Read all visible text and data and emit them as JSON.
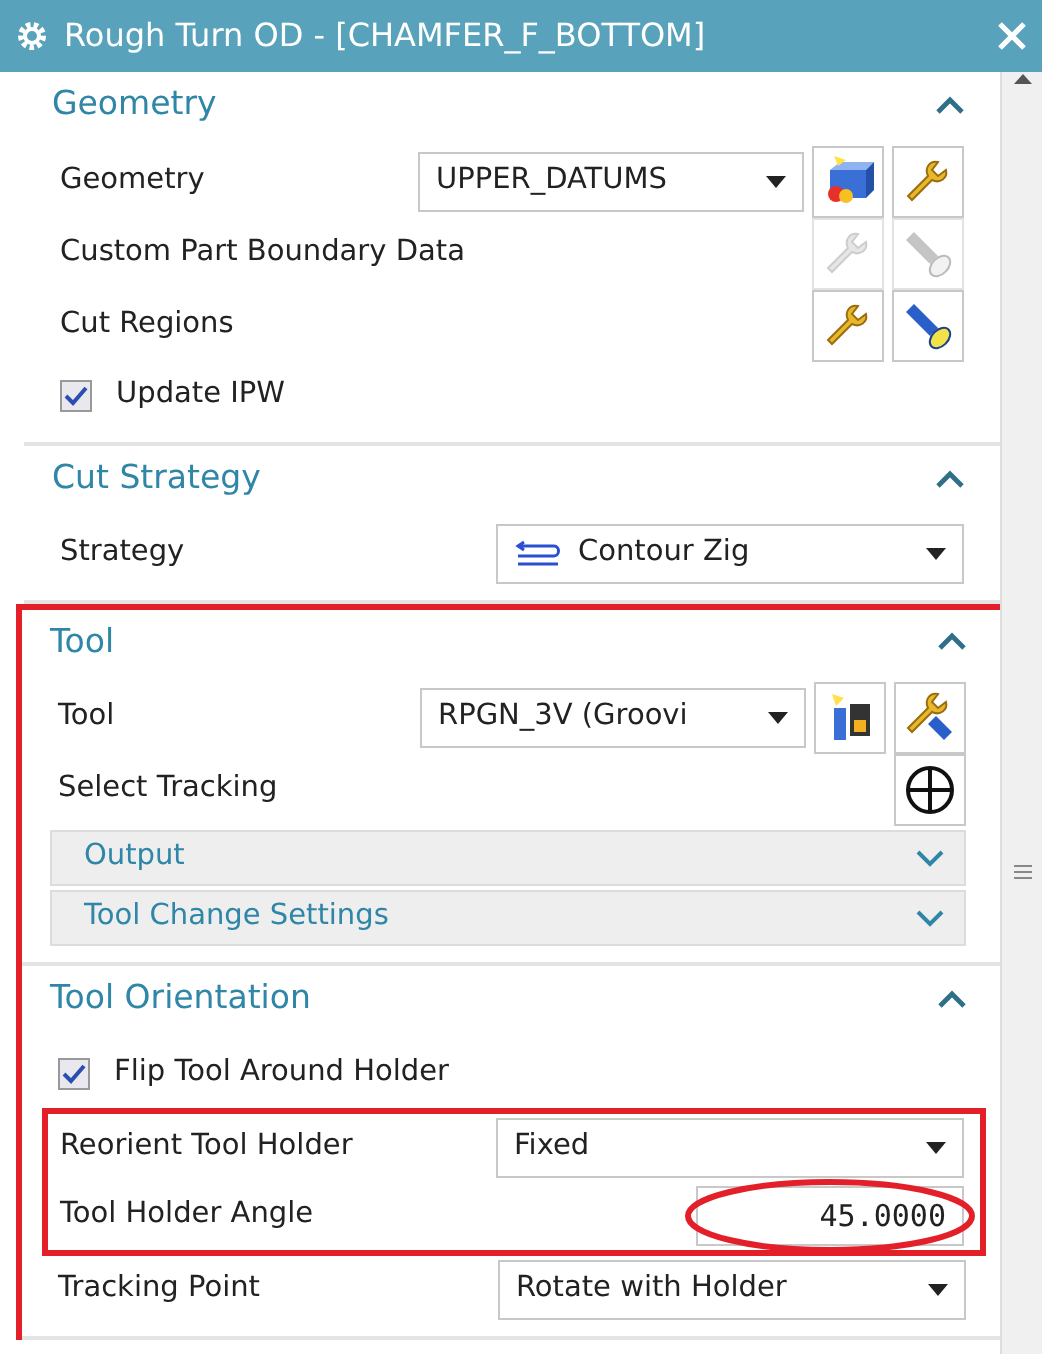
{
  "window": {
    "title": "Rough Turn OD - [CHAMFER_F_BOTTOM]"
  },
  "sections": [
    {
      "title": "Geometry",
      "expanded": true,
      "highlighted": false,
      "rows": [
        {
          "kind": "select",
          "label": "Geometry",
          "value": "UPPER_DATUMS",
          "buttons": [
            {
              "kind": "newbox",
              "disabled": false
            },
            {
              "kind": "wrench",
              "disabled": false
            }
          ]
        },
        {
          "kind": "buttons",
          "label": "Custom Part Boundary Data",
          "buttons": [
            {
              "kind": "wrench",
              "disabled": true
            },
            {
              "kind": "flashlight",
              "disabled": true
            }
          ]
        },
        {
          "kind": "buttons",
          "label": "Cut Regions",
          "buttons": [
            {
              "kind": "wrench",
              "disabled": false
            },
            {
              "kind": "flashlight",
              "disabled": false
            }
          ]
        },
        {
          "kind": "checkbox",
          "label": "Update IPW",
          "checked": true
        }
      ]
    },
    {
      "title": "Cut Strategy",
      "expanded": true,
      "highlighted": false,
      "rows": [
        {
          "kind": "iconselect",
          "label": "Strategy",
          "value": "Contour Zig"
        }
      ]
    },
    {
      "title": "Tool",
      "expanded": true,
      "highlighted": true,
      "rows": [
        {
          "kind": "select",
          "label": "Tool",
          "value": "RPGN_3V (Groovi",
          "buttons": [
            {
              "kind": "newtool",
              "disabled": false
            },
            {
              "kind": "wrenchtool",
              "disabled": false
            }
          ]
        },
        {
          "kind": "buttons",
          "label": "Select Tracking",
          "buttons": [
            {
              "kind": "crosshair",
              "disabled": false
            }
          ]
        },
        {
          "kind": "group",
          "label": "Output",
          "expanded": false
        },
        {
          "kind": "group",
          "label": "Tool Change Settings",
          "expanded": false
        }
      ]
    },
    {
      "title": "Tool Orientation",
      "expanded": true,
      "highlighted": true,
      "rows": [
        {
          "kind": "checkbox",
          "label": "Flip Tool Around Holder",
          "checked": true
        },
        {
          "kind": "select",
          "label": "Reorient Tool Holder",
          "value": "Fixed",
          "highlighted": true
        },
        {
          "kind": "number",
          "label": "Tool Holder Angle",
          "value": "45.0000",
          "highlighted": true,
          "circled": true
        },
        {
          "kind": "select",
          "label": "Tracking Point",
          "value": "Rotate with Holder",
          "highlighted": false
        }
      ]
    }
  ]
}
